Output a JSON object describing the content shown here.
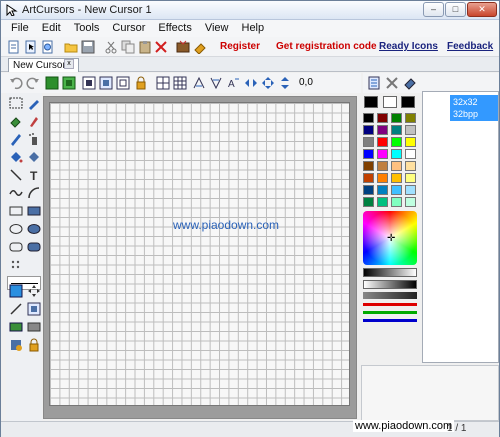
{
  "window": {
    "title": "ArtCursors - New Cursor 1",
    "controls": [
      "–",
      "□",
      "✕"
    ]
  },
  "menu": {
    "items": [
      "File",
      "Edit",
      "Tools",
      "Cursor",
      "Effects",
      "View",
      "Help"
    ]
  },
  "toolbar": {
    "register_label": "Register",
    "get_code_label": "Get registration code",
    "ready_icons_label": "Ready Icons",
    "feedback_label": "Feedback"
  },
  "tabs": {
    "active_label": "New Cursor 1",
    "close_glyph": "x"
  },
  "toolbar2": {
    "coords": "0,0"
  },
  "canvas": {
    "watermark": "www.piaodown.com"
  },
  "frames": {
    "size_label": "32x32",
    "depth_label": "32bpp"
  },
  "status": {
    "watermark": "www.piaodown.com",
    "frame_text": "1 / 1"
  },
  "colors": {
    "accent": "#3399ff",
    "link_red": "#cc0000",
    "link_blue": "#1a237e"
  },
  "palette": [
    [
      "#000000",
      "#800000",
      "#008000",
      "#808000"
    ],
    [
      "#000080",
      "#800080",
      "#008080",
      "#c0c0c0"
    ],
    [
      "#808080",
      "#ff0000",
      "#00ff00",
      "#ffff00"
    ],
    [
      "#0000ff",
      "#ff00ff",
      "#00ffff",
      "#ffffff"
    ],
    [
      "#804000",
      "#c08040",
      "#ffc080",
      "#ffe0a0"
    ],
    [
      "#c04000",
      "#ff8000",
      "#ffc000",
      "#ffff80"
    ],
    [
      "#004080",
      "#0080c0",
      "#40c0ff",
      "#a0e0ff"
    ],
    [
      "#008040",
      "#00c080",
      "#80ffc0",
      "#c0ffe0"
    ]
  ]
}
